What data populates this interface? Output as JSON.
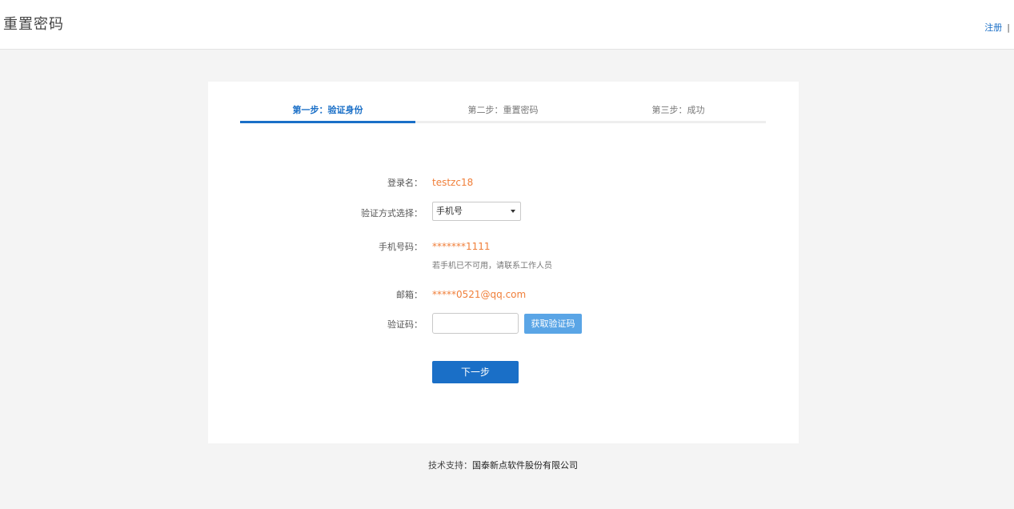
{
  "header": {
    "title": "重置密码",
    "register_link": "注册",
    "separator": "|"
  },
  "steps": [
    {
      "label": "第一步：验证身份",
      "active": true
    },
    {
      "label": "第二步：重置密码",
      "active": false
    },
    {
      "label": "第三步：成功",
      "active": false
    }
  ],
  "form": {
    "login_name_label": "登录名：",
    "login_name_value": "testzc18",
    "verify_method_label": "验证方式选择：",
    "verify_method_selected": "手机号",
    "phone_label": "手机号码：",
    "phone_value": "*******1111",
    "phone_hint": "若手机已不可用，请联系工作人员",
    "email_label": "邮箱：",
    "email_value": "*****0521@qq.com",
    "code_label": "验证码：",
    "code_value": "",
    "code_placeholder": "",
    "get_code_button": "获取验证码",
    "next_button": "下一步"
  },
  "footer": {
    "prefix": "技术支持：",
    "company": "国泰新点软件股份有限公司"
  },
  "colors": {
    "accent": "#1a6fc7",
    "value_orange": "#f07f3a",
    "secondary_button": "#5aa5e6",
    "page_background": "#f4f4f4"
  }
}
